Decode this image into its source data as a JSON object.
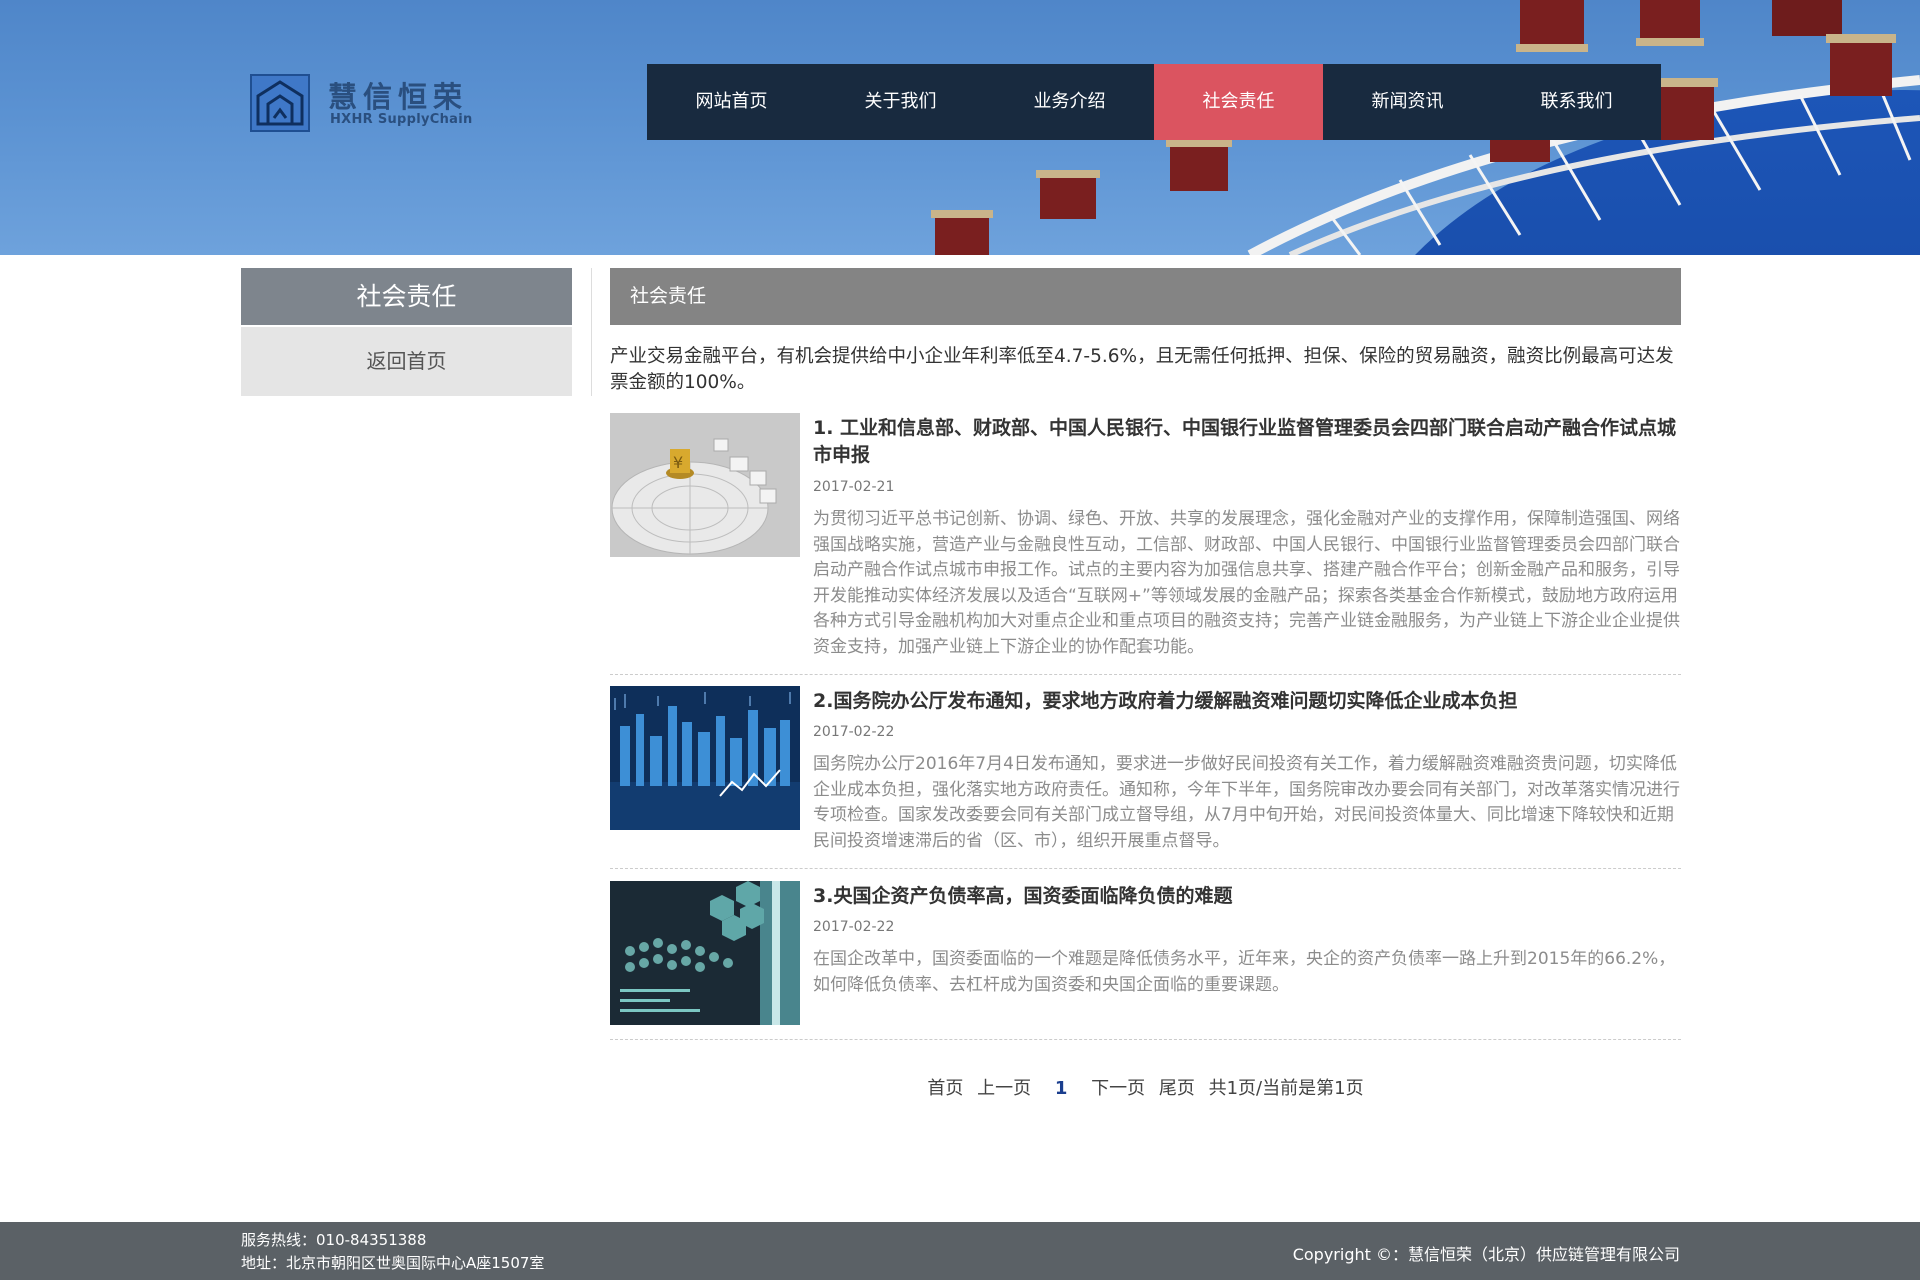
{
  "logo": {
    "cn": "慧信恒荣",
    "en": "HXHR SupplyChain"
  },
  "nav": [
    {
      "label": "网站首页",
      "active": false
    },
    {
      "label": "关于我们",
      "active": false
    },
    {
      "label": "业务介绍",
      "active": false
    },
    {
      "label": "社会责任",
      "active": true
    },
    {
      "label": "新闻资讯",
      "active": false
    },
    {
      "label": "联系我们",
      "active": false
    }
  ],
  "sidebar": {
    "title": "社会责任",
    "link": "返回首页"
  },
  "main": {
    "title": "社会责任",
    "intro": "产业交易金融平台，有机会提供给中小企业年利率低至4.7-5.6%，且无需任何抵押、担保、保险的贸易融资，融资比例最高可达发票金额的100%。"
  },
  "articles": [
    {
      "title": "1. 工业和信息部、财政部、中国人民银行、中国银行业监督管理委员会四部门联合启动产融合作试点城市申报",
      "date": "2017-02-21",
      "body": "为贯彻习近平总书记创新、协调、绿色、开放、共享的发展理念，强化金融对产业的支撑作用，保障制造强国、网络强国战略实施，营造产业与金融良性互动，工信部、财政部、中国人民银行、中国银行业监督管理委员会四部门联合启动产融合作试点城市申报工作。试点的主要内容为加强信息共享、搭建产融合作平台；创新金融产品和服务，引导开发能推动实体经济发展以及适合“互联网+”等领域发展的金融产品；探索各类基金合作新模式，鼓励地方政府运用各种方式引导金融机构加大对重点企业和重点项目的融资支持；完善产业链金融服务，为产业链上下游企业企业提供资金支持，加强产业链上下游企业的协作配套功能。"
    },
    {
      "title": "2.国务院办公厅发布通知，要求地方政府着力缓解融资难问题切实降低企业成本负担",
      "date": "2017-02-22",
      "body": "国务院办公厅2016年7月4日发布通知，要求进一步做好民间投资有关工作，着力缓解融资难融资贵问题，切实降低企业成本负担，强化落实地方政府责任。通知称，今年下半年，国务院审改办要会同有关部门，对改革落实情况进行专项检查。国家发改委要会同有关部门成立督导组，从7月中旬开始，对民间投资体量大、同比增速下降较快和近期民间投资增速滞后的省（区、市），组织开展重点督导。"
    },
    {
      "title": "3.央国企资产负债率高，国资委面临降负债的难题",
      "date": "2017-02-22",
      "body": "在国企改革中，国资委面临的一个难题是降低债务水平，近年来，央企的资产负债率一路上升到2015年的66.2%，如何降低负债率、去杠杆成为国资委和央国企面临的重要课题。"
    }
  ],
  "pager": {
    "first": "首页",
    "prev": "上一页",
    "current": "1",
    "next": "下一页",
    "last": "尾页",
    "summary": "共1页/当前是第1页"
  },
  "footer": {
    "hotline": "服务热线：010-84351388",
    "address": "地址：北京市朝阳区世奥国际中心A座1507室",
    "copyright": "Copyright ©：慧信恒荣（北京）供应链管理有限公司"
  },
  "colors": {
    "nav_bg": "#182a3f",
    "nav_active": "#db5460",
    "sky": "#5b92d2",
    "footer": "#5b6166"
  }
}
